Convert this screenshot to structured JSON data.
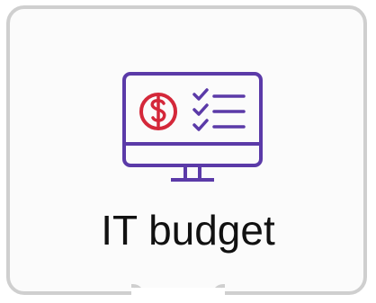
{
  "tile": {
    "label": "IT budget",
    "icon": "computer-budget-checklist-icon"
  },
  "colors": {
    "accent_purple": "#5b3aa8",
    "accent_red": "#d4283a",
    "border": "#cfcfcf",
    "text": "#111111"
  }
}
